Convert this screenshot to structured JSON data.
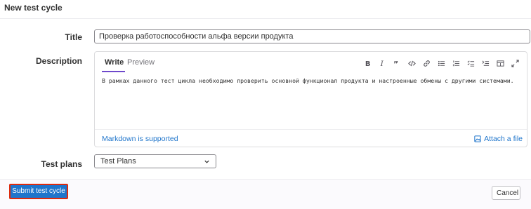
{
  "page": {
    "title": "New test cycle"
  },
  "form": {
    "title_label": "Title",
    "title_value": "Проверка работоспособности альфа версии продукта",
    "description_label": "Description",
    "test_plans_label": "Test plans"
  },
  "editor": {
    "tab_write": "Write",
    "tab_preview": "Preview",
    "text": "В рамках данного тест цикла необходимо проверить основной функционал продукта и настроенные обмены с другими системами.",
    "markdown_link": "Markdown is supported",
    "attach_label": "Attach a file",
    "toolbar_icons": [
      "bold-icon",
      "italic-icon",
      "quote-icon",
      "code-icon",
      "link-icon",
      "bullet-list-icon",
      "numbered-list-icon",
      "task-list-icon",
      "collapsible-icon",
      "table-icon",
      "fullscreen-icon"
    ]
  },
  "select": {
    "value": "Test Plans"
  },
  "actions": {
    "submit_label": "Submit test cycle",
    "cancel_label": "Cancel"
  },
  "colors": {
    "primary": "#1f75cb",
    "highlight_border": "#dd2b0e",
    "tab_accent": "#6e49cb"
  }
}
